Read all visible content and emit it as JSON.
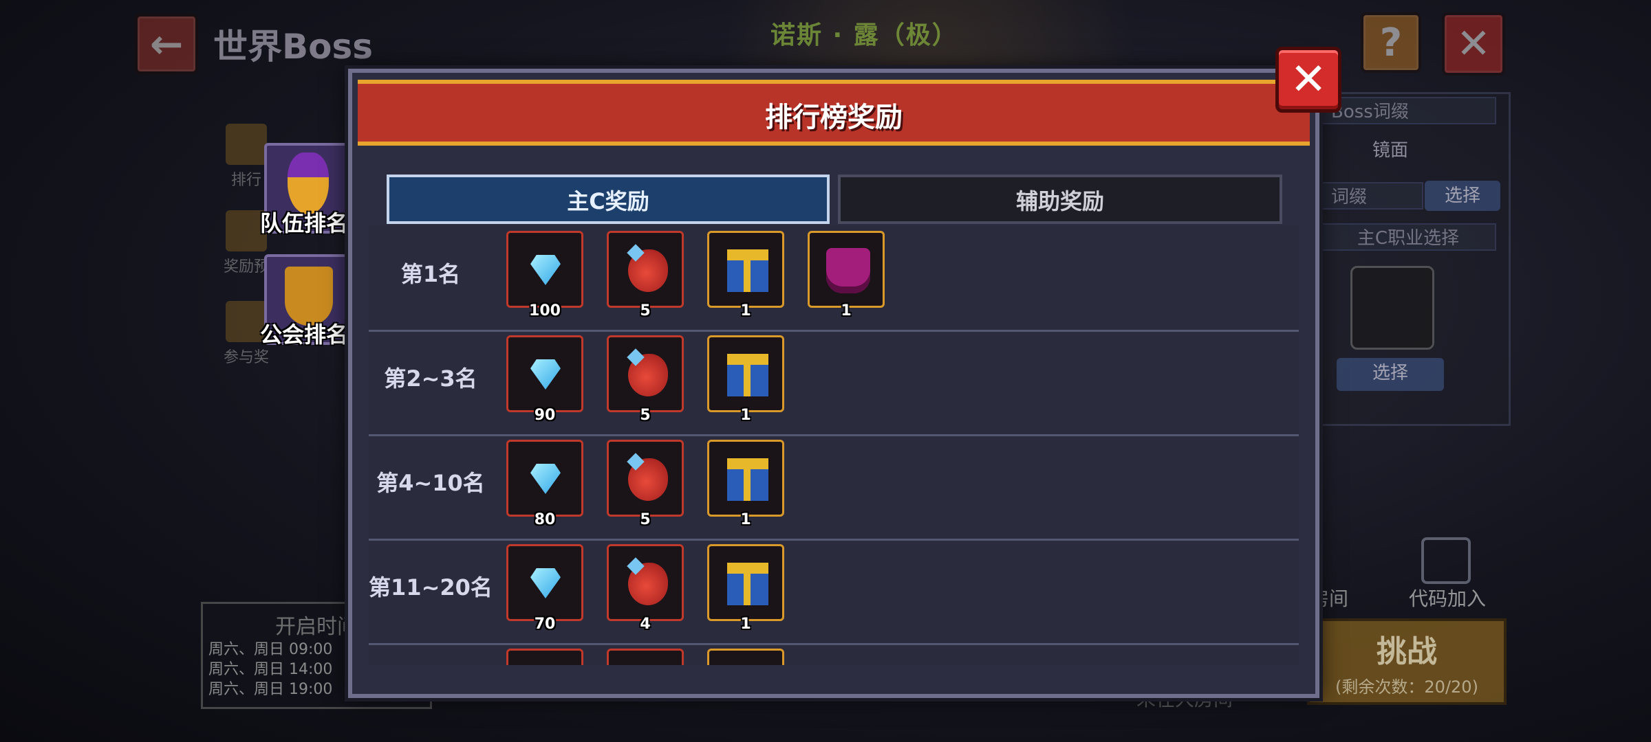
{
  "background": {
    "back_icon": "arrow-left-icon",
    "page_title": "世界Boss",
    "boss_name": "诺斯 · 露（极）",
    "help_icon": "?",
    "close_icon": "✕",
    "side_tabs": [
      {
        "label": "排行",
        "icon": "trophy-icon"
      },
      {
        "label": "奖励预",
        "icon": "chest-icon"
      },
      {
        "label": "参与奖",
        "icon": "gift-icon"
      }
    ],
    "team_rank_label": "队伍排名",
    "guild_rank_label": "公会排名",
    "schedule": {
      "title": "开启时间",
      "lines": [
        "周六、周日 09:00",
        "周六、周日 14:00",
        "周六、周日 19:00"
      ]
    },
    "right_panel": {
      "boss_affix": "Boss词缀",
      "mirror": "镜面",
      "affix": "词缀",
      "select": "选择",
      "main_class_select": "主C职业选择",
      "select2": "选择",
      "room": "房间",
      "code_join": "代码加入",
      "challenge": "挑战",
      "remaining": "(剩余次数：20/20)",
      "room_note": "未在大房间"
    }
  },
  "modal": {
    "title": "排行榜奖励",
    "close_icon": "✕",
    "tabs": [
      {
        "label": "主C奖励",
        "active": true
      },
      {
        "label": "辅助奖励",
        "active": false
      }
    ],
    "rows": [
      {
        "rank": "第1名",
        "rewards": [
          {
            "icon": "diamond-icon",
            "count": "100"
          },
          {
            "icon": "red-dragon-icon",
            "count": "5"
          },
          {
            "icon": "treasure-chest-icon",
            "count": "1"
          },
          {
            "icon": "purple-armor-icon",
            "count": "1"
          }
        ]
      },
      {
        "rank": "第2~3名",
        "rewards": [
          {
            "icon": "diamond-icon",
            "count": "90"
          },
          {
            "icon": "red-dragon-icon",
            "count": "5"
          },
          {
            "icon": "treasure-chest-icon",
            "count": "1"
          }
        ]
      },
      {
        "rank": "第4~10名",
        "rewards": [
          {
            "icon": "diamond-icon",
            "count": "80"
          },
          {
            "icon": "red-dragon-icon",
            "count": "5"
          },
          {
            "icon": "treasure-chest-icon",
            "count": "1"
          }
        ]
      },
      {
        "rank": "第11~20名",
        "rewards": [
          {
            "icon": "diamond-icon",
            "count": "70"
          },
          {
            "icon": "red-dragon-icon",
            "count": "4"
          },
          {
            "icon": "treasure-chest-icon",
            "count": "1"
          }
        ]
      }
    ]
  },
  "colors": {
    "header_red": "#b93428",
    "header_gold": "#e8a52e",
    "active_tab": "#1c3f6b",
    "close_red": "#d42b2b"
  }
}
